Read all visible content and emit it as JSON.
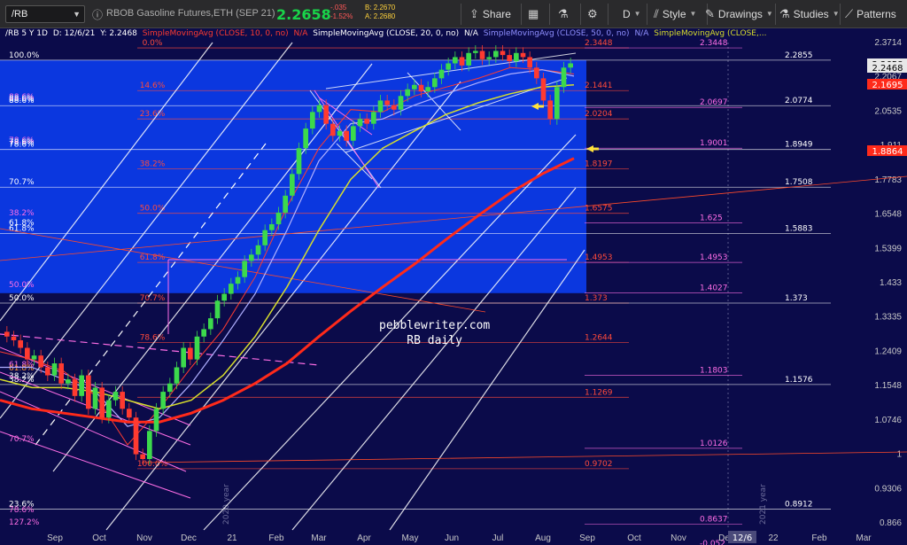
{
  "toolbar": {
    "symbol": "/RB",
    "description": "RBOB Gasoline Futures,ETH (SEP 21)",
    "last": "2.2658",
    "change_abs": "-.035",
    "change_pct": "-1.52%",
    "bid": "B: 2.2670",
    "ask": "A: 2.2680",
    "share_label": "Share",
    "interval_label": "D",
    "style_label": "Style",
    "drawings_label": "Drawings",
    "studies_label": "Studies",
    "patterns_label": "Patterns"
  },
  "status_line": {
    "ohlc": "/RB 5 Y 1D",
    "date": "D: 12/6/21",
    "y": "Y: 2.2468",
    "sma10": "SimpleMovingAvg (CLOSE, 10, 0, no)",
    "sma10_val": "N/A",
    "sma20": "SimpleMovingAvg (CLOSE, 20, 0, no)",
    "sma20_val": "N/A",
    "sma50": "SimpleMovingAvg (CLOSE, 50, 0, no)",
    "sma50_val": "N/A",
    "sma_more": "SimpleMovingAvg (CLOSE,..."
  },
  "watermark": {
    "line1": "pebblewriter.com",
    "line2": "RB daily"
  },
  "colors": {
    "background": "#0b0b4a",
    "fib_box": "#0b3cf0",
    "sma10": "#ff3b30",
    "sma20": "#b0b0ff",
    "sma50": "#d8de2c",
    "sma200": "#ff2a1a",
    "fib_red": "#ff4a3a",
    "fib_pink": "#ff6ee6",
    "price_badge_white": "#e8e8e8",
    "price_badge_red": "#ff2a1a"
  },
  "chart_data": {
    "type": "candlestick",
    "title": "RBOB Gasoline Futures,ETH (SEP 21)",
    "x_ticks": [
      "Sep",
      "Oct",
      "Nov",
      "Dec",
      "21",
      "Feb",
      "Mar",
      "Apr",
      "May",
      "Jun",
      "Jul",
      "Aug",
      "Sep",
      "Oct",
      "Nov",
      "Dec",
      "22",
      "Feb",
      "Mar"
    ],
    "x_tick_highlight": "12/6",
    "year_labels": [
      "2020 year",
      "2021 year"
    ],
    "y_ticks": [
      "2.3714",
      "2.2067",
      "2.0535",
      "1.911",
      "1.7783",
      "1.6548",
      "1.5399",
      "1.433",
      "1.3335",
      "1.2409",
      "1.1548",
      "1.0746",
      "1",
      "0.9306",
      "0.866"
    ],
    "y_scale": "log",
    "ylim": [
      0.866,
      2.3714
    ],
    "price_badges": [
      {
        "label": "2.2658",
        "style": "white"
      },
      {
        "label": "2.2468",
        "style": "white"
      },
      {
        "label": "2.1695",
        "style": "red"
      },
      {
        "label": "1.8864",
        "style": "red"
      }
    ],
    "fib_red_levels": [
      {
        "pct": "0.0%",
        "value": "2.3448"
      },
      {
        "pct": "14.6%",
        "value": "2.1441"
      },
      {
        "pct": "23.6%",
        "value": "2.0204"
      },
      {
        "pct": "38.2%",
        "value": "1.8197"
      },
      {
        "pct": "50.0%",
        "value": "1.6575"
      },
      {
        "pct": "61.8%",
        "value": "1.4953"
      },
      {
        "pct": "70.7%",
        "value": "1.373"
      },
      {
        "pct": "78.6%",
        "value": "1.2644"
      },
      {
        "pct": "",
        "value": "1.1269"
      },
      {
        "pct": "100.0%",
        "value": "0.9702"
      }
    ],
    "fib_pink_levels": [
      {
        "pct": "",
        "value": "2.3448"
      },
      {
        "pct": "",
        "value": "2.0697"
      },
      {
        "pct": "",
        "value": "1.9001"
      },
      {
        "pct": "",
        "value": "1.625"
      },
      {
        "pct": "",
        "value": "1.4953"
      },
      {
        "pct": "",
        "value": "1.4027"
      },
      {
        "pct": "",
        "value": "1.1803"
      },
      {
        "pct": "",
        "value": "1.0126"
      },
      {
        "pct": "",
        "value": "0.8637"
      },
      {
        "pct": "",
        "value": "-0.052"
      }
    ],
    "fib_white_levels": [
      {
        "pct": "100.0%",
        "value": "2.2855"
      },
      {
        "pct": "88.6%",
        "value": "2.0774"
      },
      {
        "pct": "78.6%",
        "value": "1.8949"
      },
      {
        "pct": "70.7%",
        "value": "1.7508"
      },
      {
        "pct": "61.8%",
        "value": "1.5883"
      },
      {
        "pct": "50.0%",
        "value": "1.373"
      },
      {
        "pct": "38.2%",
        "value": "1.1576"
      },
      {
        "pct": "23.6%",
        "value": "0.8912"
      }
    ],
    "left_pink_labels": [
      "88.6%",
      "78.6%",
      "38.2%",
      "50.0%",
      "61.8%",
      "70.7%",
      "78.6%",
      "127.2%"
    ],
    "left_white_labels": [
      "88.6%",
      "78.6%",
      "61.8%",
      "38.2%"
    ],
    "left_orange_label": "61.8%",
    "series": [
      {
        "name": "SMA 10",
        "values": [
          1.24,
          1.22,
          1.19,
          1.13,
          1.02,
          1.1,
          1.2,
          1.3,
          1.45,
          1.68,
          1.9,
          2.06,
          2.05,
          2.12,
          2.16,
          2.2,
          2.25,
          2.24,
          2.22
        ]
      },
      {
        "name": "SMA 20",
        "values": [
          1.2,
          1.2,
          1.17,
          1.14,
          1.06,
          1.08,
          1.16,
          1.27,
          1.4,
          1.6,
          1.85,
          2.0,
          2.02,
          2.08,
          2.13,
          2.18,
          2.22,
          2.24,
          2.21
        ]
      },
      {
        "name": "SMA 50",
        "values": [
          1.17,
          1.15,
          1.15,
          1.14,
          1.12,
          1.1,
          1.12,
          1.18,
          1.28,
          1.42,
          1.6,
          1.78,
          1.9,
          1.97,
          2.04,
          2.09,
          2.13,
          2.16,
          2.17
        ]
      },
      {
        "name": "SMA 200",
        "values": [
          1.12,
          1.1,
          1.09,
          1.08,
          1.07,
          1.07,
          1.09,
          1.12,
          1.16,
          1.21,
          1.28,
          1.35,
          1.42,
          1.49,
          1.57,
          1.65,
          1.73,
          1.8,
          1.86
        ]
      }
    ],
    "candles_close": [
      1.28,
      1.27,
      1.25,
      1.22,
      1.23,
      1.2,
      1.18,
      1.21,
      1.16,
      1.17,
      1.13,
      1.18,
      1.1,
      1.15,
      1.08,
      1.12,
      1.14,
      1.1,
      1.08,
      1.0,
      0.99,
      1.05,
      1.1,
      1.14,
      1.16,
      1.2,
      1.25,
      1.22,
      1.28,
      1.3,
      1.33,
      1.38,
      1.4,
      1.43,
      1.45,
      1.5,
      1.52,
      1.55,
      1.6,
      1.62,
      1.66,
      1.72,
      1.8,
      1.9,
      1.98,
      2.05,
      2.08,
      2.0,
      1.95,
      1.97,
      1.93,
      1.99,
      2.02,
      2.0,
      2.05,
      2.1,
      2.08,
      2.06,
      2.12,
      2.15,
      2.17,
      2.14,
      2.16,
      2.2,
      2.24,
      2.27,
      2.3,
      2.26,
      2.32,
      2.33,
      2.29,
      2.3,
      2.33,
      2.31,
      2.28,
      2.32,
      2.3,
      2.25,
      2.2,
      2.1,
      2.02,
      2.16,
      2.25,
      2.27
    ]
  }
}
